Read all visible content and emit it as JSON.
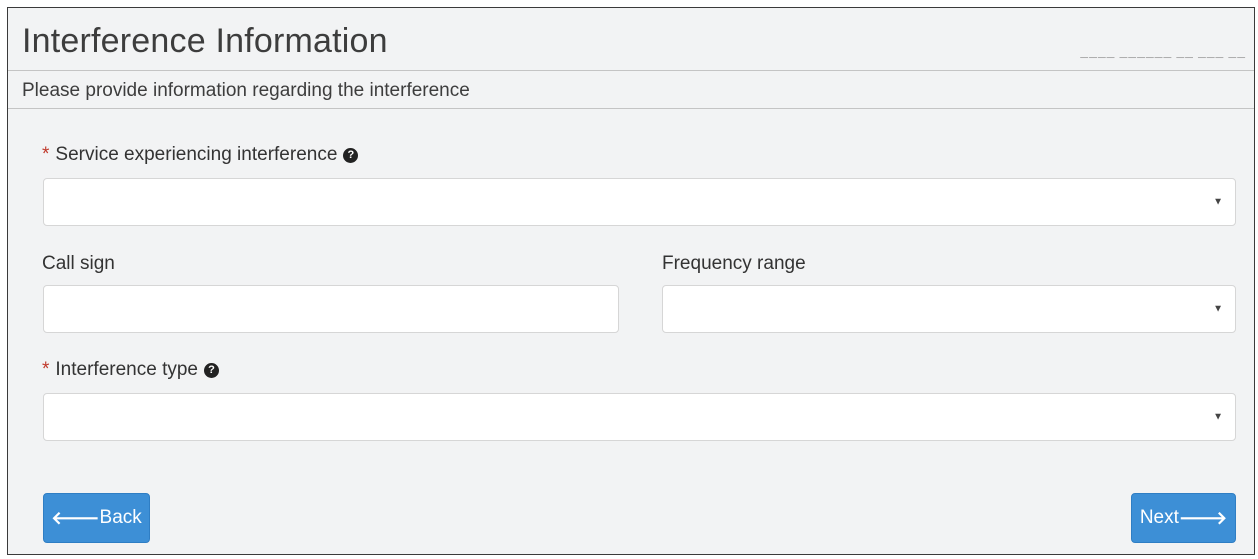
{
  "header": {
    "title": "Interference Information",
    "subtitle": "Please provide information regarding the interference"
  },
  "form": {
    "service": {
      "label": "Service experiencing interference",
      "required_mark": "*",
      "help_icon": "question-circle-icon",
      "value": ""
    },
    "call_sign": {
      "label": "Call sign",
      "value": ""
    },
    "frequency_range": {
      "label": "Frequency range",
      "value": ""
    },
    "interference_type": {
      "label": "Interference type",
      "required_mark": "*",
      "help_icon": "question-circle-icon",
      "value": ""
    }
  },
  "icons": {
    "help": "?",
    "dropdown": "▼",
    "back_arrow": "🡐",
    "next_arrow": "🡒"
  },
  "buttons": {
    "back_label": "Back",
    "next_label": "Next"
  },
  "colors": {
    "primary": "#3d8fd6",
    "required": "#c0392b",
    "panel_bg": "#f2f3f4"
  }
}
